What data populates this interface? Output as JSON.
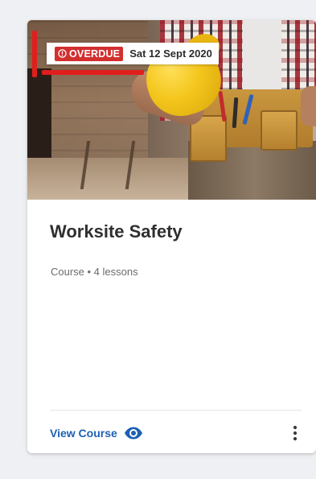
{
  "card": {
    "overdue_badge": "OVERDUE",
    "due_date": "Sat 12 Sept 2020",
    "title": "Worksite Safety",
    "meta": "Course • 4 lessons",
    "action_label": "View Course",
    "icons": {
      "badge": "alert-circle-icon",
      "action": "eye-icon",
      "menu": "more-vert-icon"
    },
    "colors": {
      "overdue": "#d32f2f",
      "link": "#1e5fb3",
      "annotation": "#e01e1e"
    }
  }
}
